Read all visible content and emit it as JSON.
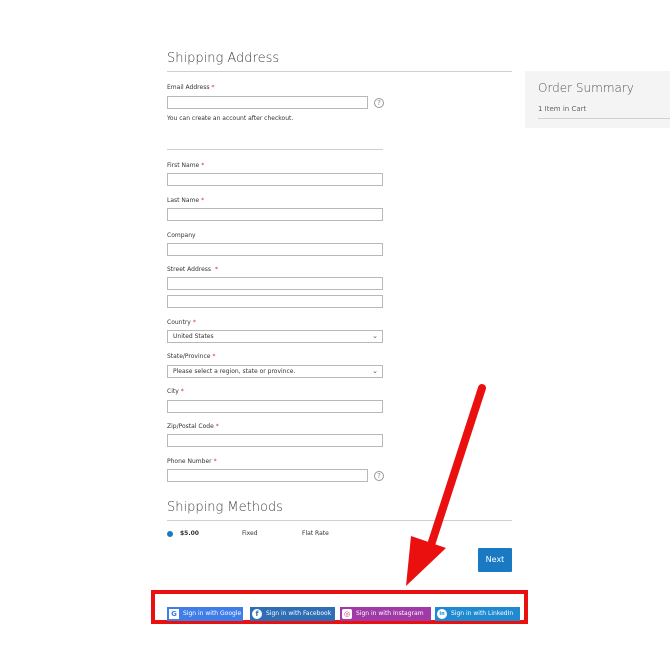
{
  "shipping": {
    "title": "Shipping Address",
    "email": {
      "label": "Email Address",
      "value": "",
      "note": "You can create an account after checkout."
    },
    "first_name": {
      "label": "First Name",
      "value": ""
    },
    "last_name": {
      "label": "Last Name",
      "value": ""
    },
    "company": {
      "label": "Company",
      "value": ""
    },
    "street": {
      "label": "Street Address",
      "value1": "",
      "value2": ""
    },
    "country": {
      "label": "Country",
      "selected": "United States"
    },
    "state": {
      "label": "State/Province",
      "selected": "Please select a region, state or province."
    },
    "city": {
      "label": "City",
      "value": ""
    },
    "zip": {
      "label": "Zip/Postal Code",
      "value": ""
    },
    "phone": {
      "label": "Phone Number",
      "value": ""
    },
    "required_mark": "*",
    "help_glyph": "?",
    "chevron_glyph": "⌄"
  },
  "methods": {
    "title": "Shipping Methods",
    "rows": [
      {
        "price": "$5.00",
        "method": "Fixed",
        "carrier": "Flat Rate",
        "selected": true
      }
    ],
    "next_label": "Next"
  },
  "summary": {
    "title": "Order Summary",
    "items": "1 Item in Cart"
  },
  "social": {
    "google": {
      "label": "Sign in with Google",
      "icon": "G",
      "color": "#3f7ee8"
    },
    "facebook": {
      "label": "Sign in with Facebook",
      "icon": "f",
      "color": "#2f6db5"
    },
    "instagram": {
      "label": "Sign in with Instagram",
      "icon": "◎",
      "color": "#a03aa6"
    },
    "linkedin": {
      "label": "Sign in with LinkedIn",
      "icon": "in",
      "color": "#1f8ad0"
    }
  },
  "colors": {
    "accent": "#1979c3",
    "highlight": "#ea1010"
  }
}
